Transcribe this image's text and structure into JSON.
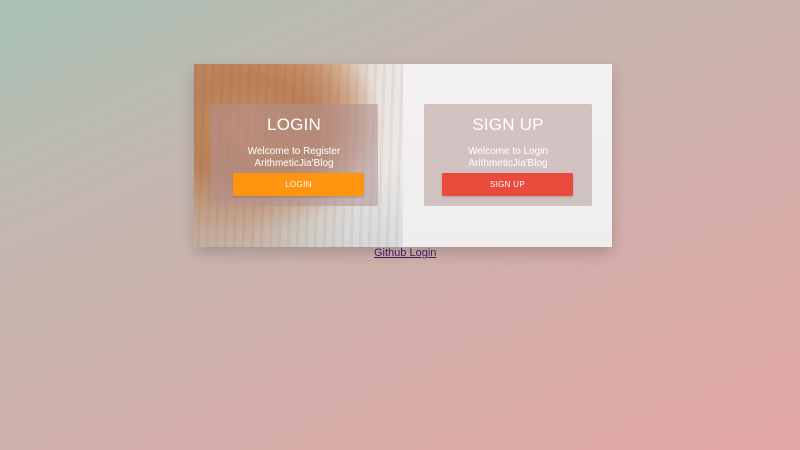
{
  "login_panel": {
    "title": "LOGIN",
    "line1": "Welcome to Register",
    "line2": "ArithmeticJia'Blog",
    "button_label": "LOGIN",
    "button_color": "#ff9410"
  },
  "signup_panel": {
    "title": "SIGN UP",
    "line1": "Welcome to Login",
    "line2": "ArithmeticJia'Blog",
    "button_label": "SIGN UP",
    "button_color": "#ea4b3d"
  },
  "github_link": {
    "label": "Github Login"
  }
}
